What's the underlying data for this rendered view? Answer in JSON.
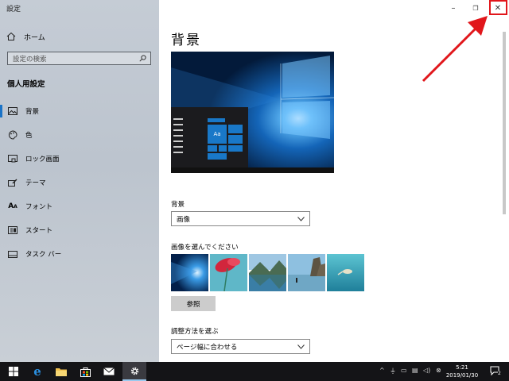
{
  "app": {
    "title": "設定"
  },
  "sidebar": {
    "home_label": "ホーム",
    "search_placeholder": "設定の検索",
    "section_title": "個人用設定",
    "items": [
      {
        "label": "背景",
        "icon": "picture-icon",
        "active": true
      },
      {
        "label": "色",
        "icon": "palette-icon",
        "active": false
      },
      {
        "label": "ロック画面",
        "icon": "lock-screen-icon",
        "active": false
      },
      {
        "label": "テーマ",
        "icon": "theme-brush-icon",
        "active": false
      },
      {
        "label": "フォント",
        "icon": "font-icon",
        "active": false
      },
      {
        "label": "スタート",
        "icon": "start-icon",
        "active": false
      },
      {
        "label": "タスク バー",
        "icon": "taskbar-icon",
        "active": false
      }
    ]
  },
  "main": {
    "title": "背景",
    "preview_tile_label": "Aa",
    "background_label": "背景",
    "background_value": "画像",
    "choose_picture_label": "画像を選んでください",
    "browse_label": "参照",
    "fit_label": "調整方法を選ぶ",
    "fit_value": "ページ幅に合わせる"
  },
  "window_controls": {
    "minimize": "–",
    "maximize": "❐",
    "close": "✕"
  },
  "taskbar": {
    "clock_time": "5:21",
    "clock_date": "2019/01/30",
    "notification_count": "2"
  },
  "colors": {
    "accent": "#1a73c7",
    "annotation": "#e1161b"
  }
}
